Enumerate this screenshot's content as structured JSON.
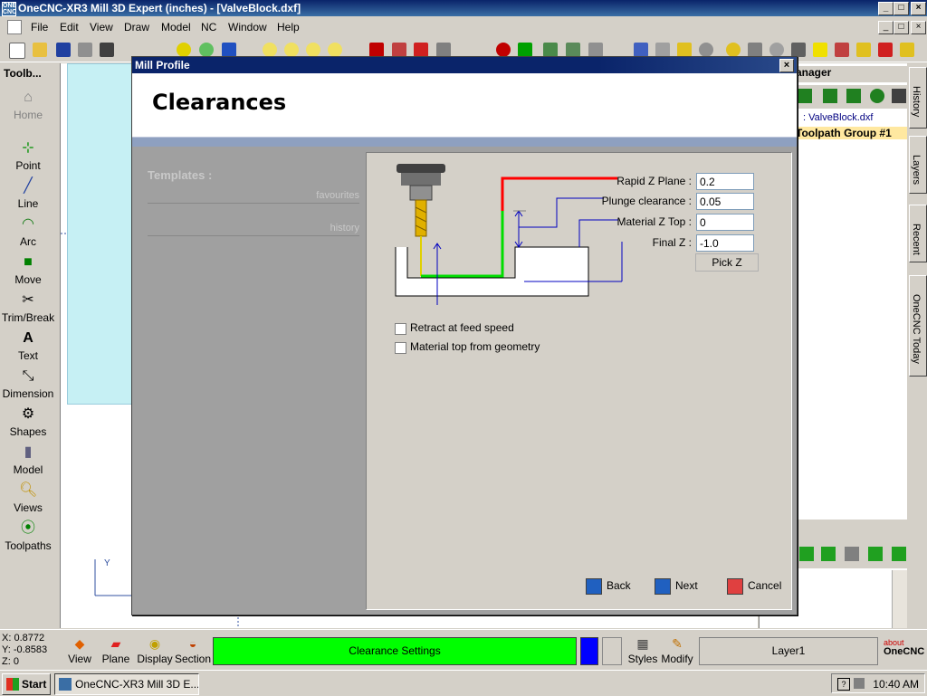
{
  "window": {
    "title": "OneCNC-XR3 Mill 3D Expert (inches) - [ValveBlock.dxf]",
    "logo_text": "ONE CNC",
    "min_glyph": "_",
    "restore_glyph": "□",
    "close_glyph": "×"
  },
  "menu": [
    "File",
    "Edit",
    "View",
    "Draw",
    "Model",
    "NC",
    "Window",
    "Help"
  ],
  "toolbox": {
    "title": "Toolb...",
    "items": [
      "Home",
      "Point",
      "Line",
      "Arc",
      "Move",
      "Trim/Break",
      "Text",
      "Dimension",
      "Shapes",
      "Model",
      "Views",
      "Toolpaths"
    ]
  },
  "manager": {
    "title": "anager",
    "file": ": ValveBlock.dxf",
    "group": "Toolpath Group #1"
  },
  "right_tabs": [
    "History",
    "Layers",
    "Recent",
    "OneCNC Today"
  ],
  "dialog": {
    "title": "Mill Profile",
    "heading": "Clearances",
    "templates_label": "Templates :",
    "template_links": [
      "favourites",
      "history"
    ],
    "fields": [
      {
        "label": "Rapid Z Plane :",
        "value": "0.2"
      },
      {
        "label": "Plunge clearance :",
        "value": "0.05"
      },
      {
        "label": "Material Z Top :",
        "value": "0"
      },
      {
        "label": "Final Z :",
        "value": "-1.0"
      }
    ],
    "pick_z": "Pick Z",
    "checkboxes": [
      {
        "label": "Retract at feed speed",
        "checked": false
      },
      {
        "label": "Material top from geometry",
        "checked": false
      }
    ],
    "buttons": {
      "back": "Back",
      "next": "Next",
      "cancel": "Cancel"
    }
  },
  "coords": {
    "x": "X: 0.8772",
    "y": "Y: -0.8583",
    "z": "Z: 0"
  },
  "bottom_tools": [
    "View",
    "Plane",
    "Display",
    "Section"
  ],
  "status": "Clearance Settings",
  "right_tools": [
    "Styles",
    "Modify"
  ],
  "layer": "Layer1",
  "brand": {
    "about": "about",
    "name": "OneCNC"
  },
  "taskbar": {
    "start": "Start",
    "task": "OneCNC-XR3 Mill 3D E...",
    "time": "10:40 AM"
  },
  "colors": {
    "status_green": "#00ff00",
    "rapid_red": "#ff0000",
    "feed_green": "#00dd00",
    "tool_gold": "#e0b000"
  }
}
